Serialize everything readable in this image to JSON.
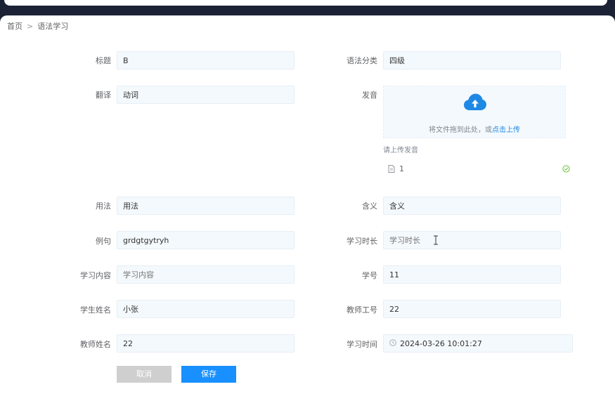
{
  "breadcrumb": {
    "home": "首页",
    "separator": ">",
    "current": "语法学习"
  },
  "form": {
    "title_label": "标题",
    "title_value": "B",
    "translation_label": "翻译",
    "translation_value": "动词",
    "usage_label": "用法",
    "usage_value": "用法",
    "example_label": "例句",
    "example_value": "grdgtgytryh",
    "content_label": "学习内容",
    "content_placeholder": "学习内容",
    "student_name_label": "学生姓名",
    "student_name_value": "小张",
    "teacher_name_label": "教师姓名",
    "teacher_name_value": "22",
    "category_label": "语法分类",
    "category_value": "四级",
    "pronunciation_label": "发音",
    "meaning_label": "含义",
    "meaning_value": "含义",
    "duration_label": "学习时长",
    "duration_placeholder": "学习时长",
    "student_id_label": "学号",
    "student_id_value": "11",
    "teacher_id_label": "教师工号",
    "teacher_id_value": "22",
    "study_time_label": "学习时间",
    "study_time_value": "2024-03-26 10:01:27"
  },
  "upload": {
    "drag_text": "将文件拖到此处，或",
    "click_text": "点击上传",
    "tip": "请上传发音",
    "file_name": "1"
  },
  "buttons": {
    "cancel": "取消",
    "save": "保存"
  },
  "colors": {
    "primary": "#1890ff",
    "cancel": "#cfcfcf",
    "input_bg": "#f4f9fd",
    "success": "#67c23a"
  },
  "icons": [
    "upload-cloud-icon",
    "file-icon",
    "success-check-icon",
    "clock-icon",
    "text-cursor-icon"
  ]
}
